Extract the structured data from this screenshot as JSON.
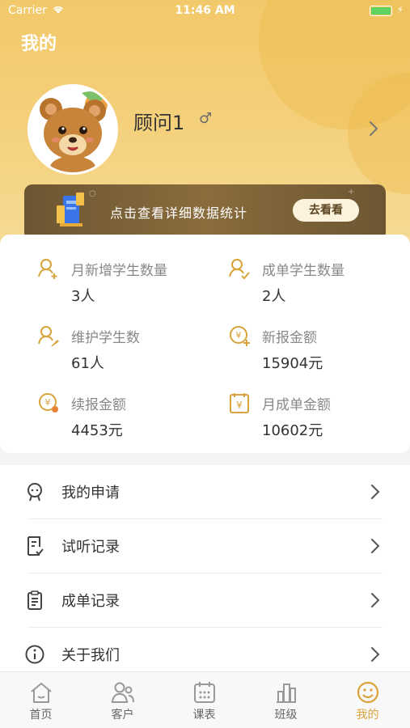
{
  "status_bar": {
    "carrier": "Carrier",
    "time": "11:46 AM"
  },
  "page_title": "我的",
  "profile": {
    "name": "顾问1",
    "gender_symbol": "♂"
  },
  "banner": {
    "text": "点击查看详细数据统计",
    "button": "去看看"
  },
  "stats": [
    {
      "label": "月新增学生数量",
      "value": "3人",
      "icon": "student-add-icon"
    },
    {
      "label": "成单学生数量",
      "value": "2人",
      "icon": "student-check-icon"
    },
    {
      "label": "维护学生数",
      "value": "61人",
      "icon": "student-edit-icon"
    },
    {
      "label": "新报金额",
      "value": "15904元",
      "icon": "yuan-add-icon"
    },
    {
      "label": "续报金额",
      "value": "4453元",
      "icon": "yuan-renew-icon"
    },
    {
      "label": "月成单金额",
      "value": "10602元",
      "icon": "yuan-calendar-icon"
    }
  ],
  "menu": [
    {
      "label": "我的申请",
      "icon": "application-icon"
    },
    {
      "label": "试听记录",
      "icon": "trial-record-icon"
    },
    {
      "label": "成单记录",
      "icon": "order-record-icon"
    },
    {
      "label": "关于我们",
      "icon": "info-icon"
    }
  ],
  "tabs": [
    {
      "label": "首页",
      "icon": "home-icon"
    },
    {
      "label": "客户",
      "icon": "customers-icon"
    },
    {
      "label": "课表",
      "icon": "calendar-icon"
    },
    {
      "label": "班级",
      "icon": "class-icon"
    },
    {
      "label": "我的",
      "icon": "smile-icon",
      "active": true
    }
  ],
  "colors": {
    "accent": "#d8a33a",
    "header_start": "#f2c96a",
    "header_end": "#f7dc97",
    "banner": "#7a6136"
  }
}
